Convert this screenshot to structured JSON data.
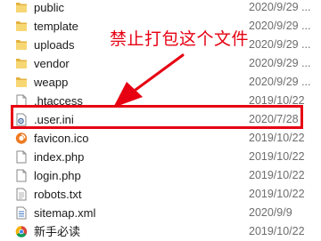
{
  "annotation": {
    "text": "禁止打包这个文件",
    "color": "#e60012"
  },
  "files": [
    {
      "name": "public",
      "date": "2020/9/29 ...",
      "icon": "folder-icon"
    },
    {
      "name": "template",
      "date": "2020/9/29 ...",
      "icon": "folder-icon"
    },
    {
      "name": "uploads",
      "date": "2020/9/29 ...",
      "icon": "folder-icon"
    },
    {
      "name": "vendor",
      "date": "2020/9/29 ...",
      "icon": "folder-icon"
    },
    {
      "name": "weapp",
      "date": "2020/9/29 ...",
      "icon": "folder-icon"
    },
    {
      "name": ".htaccess",
      "date": "2019/10/22",
      "icon": "file-icon"
    },
    {
      "name": ".user.ini",
      "date": "2020/7/28",
      "icon": "settings-file-icon"
    },
    {
      "name": "favicon.ico",
      "date": "2019/10/22",
      "icon": "ico-file-icon"
    },
    {
      "name": "index.php",
      "date": "2019/10/22",
      "icon": "file-icon"
    },
    {
      "name": "login.php",
      "date": "2019/10/22",
      "icon": "file-icon"
    },
    {
      "name": "robots.txt",
      "date": "2019/10/22",
      "icon": "text-file-icon"
    },
    {
      "name": "sitemap.xml",
      "date": "2020/9/9",
      "icon": "xml-file-icon"
    },
    {
      "name": "新手必读",
      "date": "2019/10/22",
      "icon": "browser-shortcut-icon"
    }
  ]
}
